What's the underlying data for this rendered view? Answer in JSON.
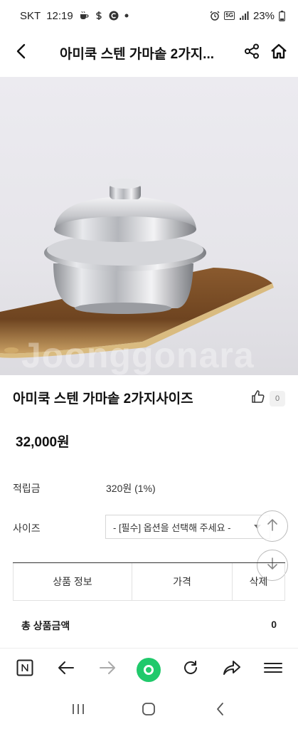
{
  "status_bar": {
    "carrier": "SKT",
    "time": "12:19",
    "network": "5G",
    "battery": "23%"
  },
  "header": {
    "title": "아미쿡 스텐 가마솥 2가지..."
  },
  "image": {
    "watermark": "Joonggonara"
  },
  "product": {
    "title": "아미쿡 스텐 가마솥 2가지사이즈",
    "like_count": "0",
    "price": "32,000원"
  },
  "info": {
    "points_label": "적립금",
    "points_value": "320원 (1%)",
    "size_label": "사이즈",
    "size_placeholder": "- [필수] 옵션을 선택해 주세요 -"
  },
  "table": {
    "headers": [
      "상품 정보",
      "가격",
      "삭제"
    ]
  },
  "total": {
    "label": "총 상품금액",
    "value": "0"
  },
  "colors": {
    "accent_green": "#20c96b",
    "text_primary": "#111111"
  },
  "icons": {
    "back": "chevron-left-icon",
    "share": "share-icon",
    "home": "home-icon",
    "like": "thumbs-up-icon",
    "scroll_up": "arrow-up-icon",
    "scroll_down": "arrow-down-icon",
    "naver": "naver-n-icon",
    "back_nav": "arrow-left-icon",
    "forward_nav": "arrow-right-icon",
    "green_dot": "green-dot-icon",
    "refresh": "refresh-icon",
    "share_nav": "share-arrow-icon",
    "menu": "menu-icon",
    "recent_apps": "recent-apps-icon",
    "home_nav": "home-circle-icon",
    "system_back": "system-back-icon"
  }
}
